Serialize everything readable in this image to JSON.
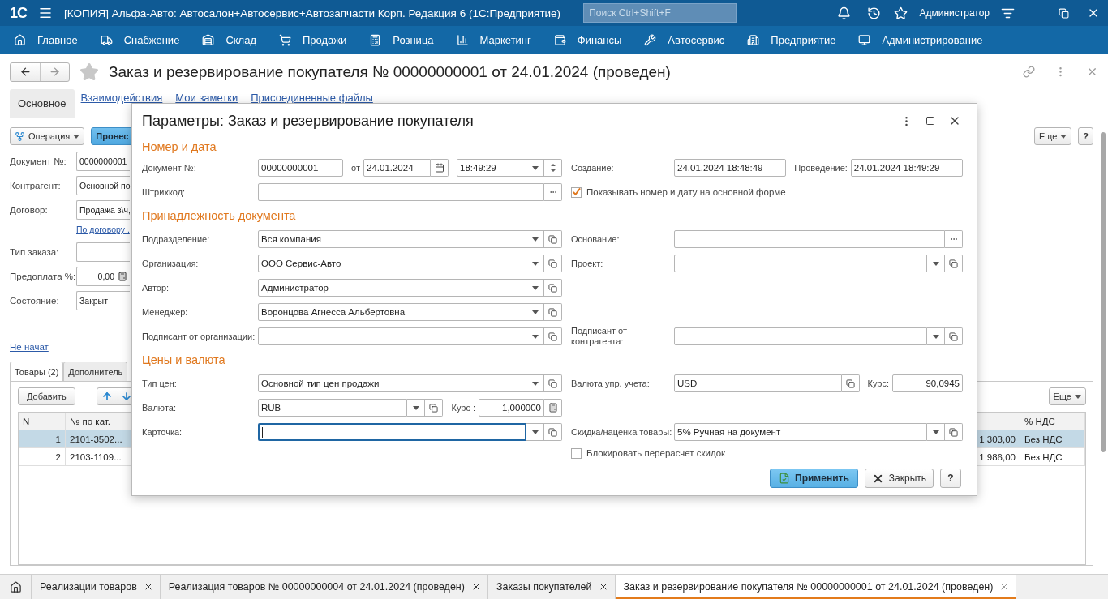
{
  "app_bar": {
    "logo": "1С",
    "title": "[КОПИЯ] Альфа-Авто: Автосалон+Автосервис+Автозапчасти Корп. Редакция 6  (1С:Предприятие)",
    "search_placeholder": "Поиск Ctrl+Shift+F",
    "user": "Администратор"
  },
  "sections": [
    {
      "label": "Главное"
    },
    {
      "label": "Снабжение"
    },
    {
      "label": "Склад"
    },
    {
      "label": "Продажи"
    },
    {
      "label": "Розница"
    },
    {
      "label": "Маркетинг"
    },
    {
      "label": "Финансы"
    },
    {
      "label": "Автосервис"
    },
    {
      "label": "Предприятие"
    },
    {
      "label": "Администрирование"
    }
  ],
  "form": {
    "title": "Заказ и резервирование покупателя № 00000000001 от 24.01.2024 (проведен)",
    "nav_tabs": [
      {
        "label": "Основное",
        "selected": true
      },
      {
        "label": "Взаимодействия",
        "selected": false
      },
      {
        "label": "Мои заметки",
        "selected": false
      },
      {
        "label": "Присоединенные файлы",
        "selected": false
      }
    ],
    "operation_button": "Операция",
    "post_button": "Провес",
    "more_button": "Еще",
    "help_button": "?",
    "fields": [
      {
        "kind": "field",
        "label": "Документ №:",
        "value": "0000000001"
      },
      {
        "kind": "field",
        "label": "Контрагент:",
        "value": "Основной по"
      },
      {
        "kind": "field",
        "label": "Договор:",
        "value": "Продажа з\\ч,"
      },
      {
        "kind": "link",
        "value": "По договору ,"
      },
      {
        "kind": "field",
        "label": "Тип заказа:"
      },
      {
        "kind": "calc",
        "label": "Предоплата %:",
        "value": "0,00"
      },
      {
        "kind": "field",
        "label": "Состояние:",
        "value": "Закрыт"
      }
    ],
    "status_link": "Не начат",
    "tabs": [
      {
        "label": "Товары (2)",
        "selected": true
      },
      {
        "label": "Дополнитель",
        "selected": false
      }
    ],
    "add_button": "Добавить",
    "table_more_button": "Еще",
    "columns": [
      "N",
      "№ по кат.",
      "% НДС"
    ],
    "rows": [
      {
        "number": "1",
        "catalog": "2101-3502...",
        "amount": "1 303,00",
        "vat": "Без НДС",
        "selected": true
      },
      {
        "number": "2",
        "catalog": "2103-1109...",
        "amount": "1 986,00",
        "vat": "Без НДС",
        "selected": false
      }
    ]
  },
  "dialog": {
    "title": "Параметры: Заказ и резервирование покупателя",
    "sections": [
      {
        "heading": "Номер и дата",
        "rows": [
          {
            "left": {
              "label": "Документ №:",
              "kind": "input",
              "value": "00000000001",
              "extra": [
                {
                  "label": "от",
                  "kind": "date",
                  "value": "24.01.2024"
                },
                {
                  "kind": "time",
                  "value": "18:49:29"
                }
              ]
            },
            "right": {
              "label": "Создание:",
              "kind": "input",
              "value": "24.01.2024 18:48:49",
              "extra": [
                {
                  "label": "Проведение:",
                  "kind": "input",
                  "value": "24.01.2024 18:49:29"
                }
              ]
            }
          },
          {
            "left": {
              "label": "Штрихкод:",
              "kind": "pick"
            },
            "right": {
              "kind": "checkbox",
              "label": "Показывать номер и дату на основной форме",
              "checked": true
            }
          }
        ]
      },
      {
        "heading": "Принадлежность документа",
        "rows": [
          {
            "left": {
              "label": "Подразделение:",
              "kind": "select",
              "value": "Вся компания"
            },
            "right": {
              "label": "Основание:",
              "kind": "pick"
            }
          },
          {
            "left": {
              "label": "Организация:",
              "kind": "select",
              "value": "ООО Сервис-Авто"
            },
            "right": {
              "label": "Проект:",
              "kind": "select"
            }
          },
          {
            "left": {
              "label": "Автор:",
              "kind": "select",
              "value": "Администратор"
            }
          },
          {
            "left": {
              "label": "Менеджер:",
              "kind": "select",
              "value": "Воронцова Агнесса Альбертовна"
            }
          },
          {
            "left": {
              "label": "Подписант от организации:",
              "kind": "select"
            },
            "right": {
              "label": "Подписант от контрагента:",
              "kind": "select"
            }
          }
        ]
      },
      {
        "heading": "Цены и валюта",
        "rows": [
          {
            "left": {
              "label": "Тип цен:",
              "kind": "select",
              "value": "Основной тип цен продажи"
            },
            "right": {
              "label": "Валюта упр. учета:",
              "kind": "open",
              "value": "USD",
              "extra": [
                {
                  "label": "Курс:",
                  "kind": "number",
                  "value": "90,0945"
                }
              ]
            }
          },
          {
            "left": {
              "label": "Валюта:",
              "kind": "select",
              "value": "RUB",
              "extra": [
                {
                  "label": "Курс :",
                  "kind": "calc",
                  "value": "1,000000"
                }
              ]
            }
          },
          {
            "left": {
              "label": "Карточка:",
              "kind": "select",
              "focused": true
            },
            "right": {
              "label": "Скидка/наценка товары:",
              "kind": "select",
              "value": "5% Ручная на документ"
            }
          },
          {
            "right": {
              "kind": "checkbox",
              "label": "Блокировать перерасчет скидок",
              "checked": false
            }
          }
        ]
      }
    ],
    "buttons": [
      {
        "label": "Применить",
        "kind": "primary"
      },
      {
        "label": "Закрыть",
        "kind": "close"
      },
      {
        "label": "?",
        "kind": "help"
      }
    ]
  },
  "open_windows": [
    {
      "label": "Реализации товаров",
      "selected": false
    },
    {
      "label": "Реализация товаров № 00000000004 от 24.01.2024 (проведен)",
      "selected": false
    },
    {
      "label": "Заказы покупателей",
      "selected": false
    },
    {
      "label": "Заказ и резервирование покупателя № 00000000001 от 24.01.2024 (проведен)",
      "selected": true
    }
  ]
}
